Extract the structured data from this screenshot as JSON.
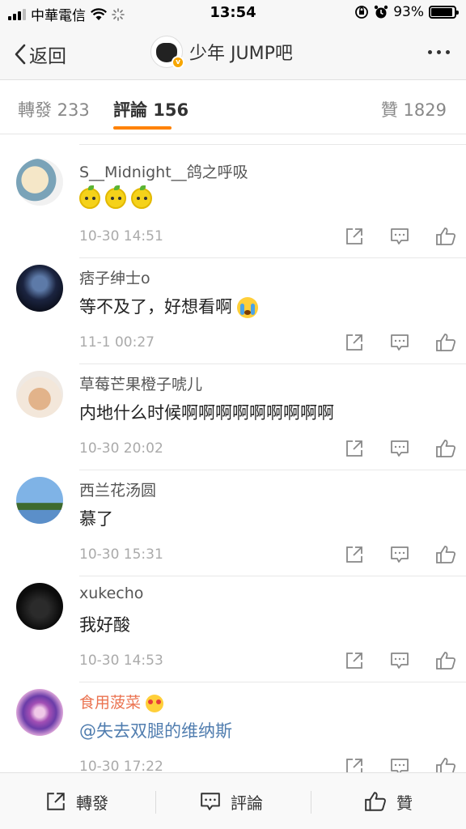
{
  "status_bar": {
    "carrier": "中華電信",
    "time": "13:54",
    "battery": "93%",
    "battery_level": 0.93
  },
  "nav": {
    "back_label": "返回",
    "title": "少年 JUMP吧"
  },
  "tabs": {
    "repost": "轉發 233",
    "comments": "評論 156",
    "likes": "贊 1829"
  },
  "comments": [
    {
      "user": "S__Midnight__鸽之呼吸",
      "text": "",
      "emoji": [
        "lemon",
        "lemon",
        "lemon"
      ],
      "time": "10-30 14:51"
    },
    {
      "user": "痞子绅士o",
      "text": "等不及了，好想看啊",
      "emoji": [
        "crying-face"
      ],
      "time": "11-1 00:27"
    },
    {
      "user": "草莓芒果橙子唬儿",
      "text": "内地什么时候啊啊啊啊啊啊啊啊啊",
      "time": "10-30 20:02"
    },
    {
      "user": "西兰花汤圆",
      "text": "慕了",
      "time": "10-30 15:31"
    },
    {
      "user": "xukecho",
      "text": "我好酸",
      "time": "10-30 14:53"
    },
    {
      "user": "食用菠菜",
      "text": "@失去双腿的维纳斯",
      "emoji": [
        "heart-eyes"
      ],
      "time": "10-30 17:22"
    }
  ],
  "bottom_bar": {
    "repost": "轉發",
    "comment": "評論",
    "like": "贊"
  },
  "colors": {
    "accent": "#ff8200",
    "link": "#507daf",
    "vip_name": "#eb7350",
    "time": "#aaaaaa"
  }
}
